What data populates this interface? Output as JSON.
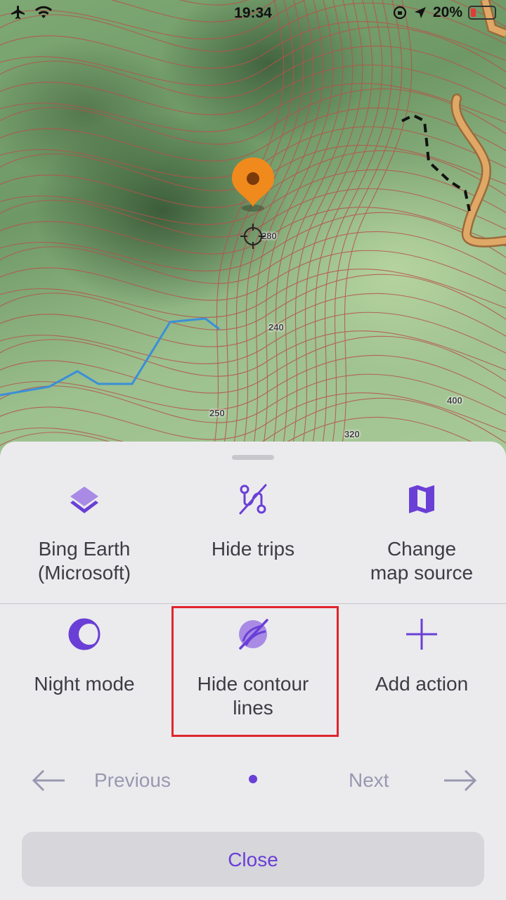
{
  "status_bar": {
    "time": "19:34",
    "battery_percent": "20%",
    "icons": [
      "airplane-icon",
      "wifi-icon",
      "orientation-lock-icon",
      "location-arrow-icon",
      "battery-icon"
    ]
  },
  "map": {
    "elevation_labels": [
      "280",
      "240",
      "250",
      "320",
      "400"
    ],
    "colors": {
      "contour": "#b5534a",
      "river": "#3a8fd8",
      "trail": "#d79a5a",
      "pin": "#f08a1c"
    }
  },
  "sheet": {
    "actions": [
      {
        "label": "Bing Earth (Microsoft)",
        "icon": "layers-icon"
      },
      {
        "label": "Hide trips",
        "icon": "hide-trips-icon"
      },
      {
        "label": "Change map source",
        "icon": "map-icon"
      },
      {
        "label": "Night mode",
        "icon": "moon-icon"
      },
      {
        "label": "Hide contour lines",
        "icon": "hide-contour-icon"
      },
      {
        "label": "Add action",
        "icon": "plus-icon"
      }
    ],
    "pager": {
      "previous": "Previous",
      "next": "Next"
    },
    "close_label": "Close",
    "accent_color": "#6a3fd6"
  }
}
